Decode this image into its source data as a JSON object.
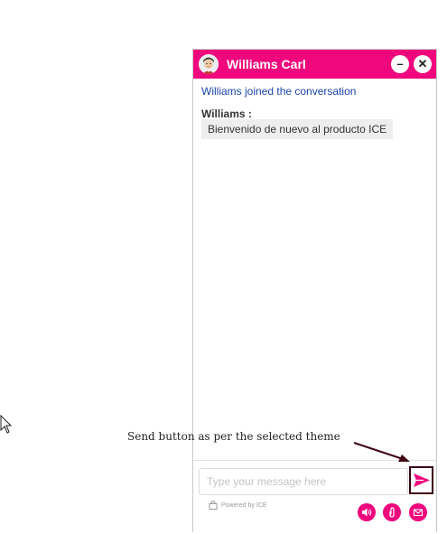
{
  "chat": {
    "agent_name": "Williams Carl",
    "minimize_symbol": "–",
    "close_symbol": "✕",
    "system_message": "Williams joined the conversation",
    "messages": [
      {
        "sender": "Williams :",
        "text": "Bienvenido de nuevo al producto ICE"
      }
    ],
    "input_placeholder": "Type your message here",
    "powered_by": "Powered by ICE",
    "theme_color": "#f0067d"
  },
  "annotation": {
    "text": "Send button as per the selected theme",
    "border_color": "#3e0414"
  },
  "icons": [
    "avatar",
    "minimize-icon",
    "close-icon",
    "send-icon",
    "lock-icon",
    "sound-icon",
    "attachment-icon",
    "email-icon",
    "mouse-cursor-icon"
  ]
}
